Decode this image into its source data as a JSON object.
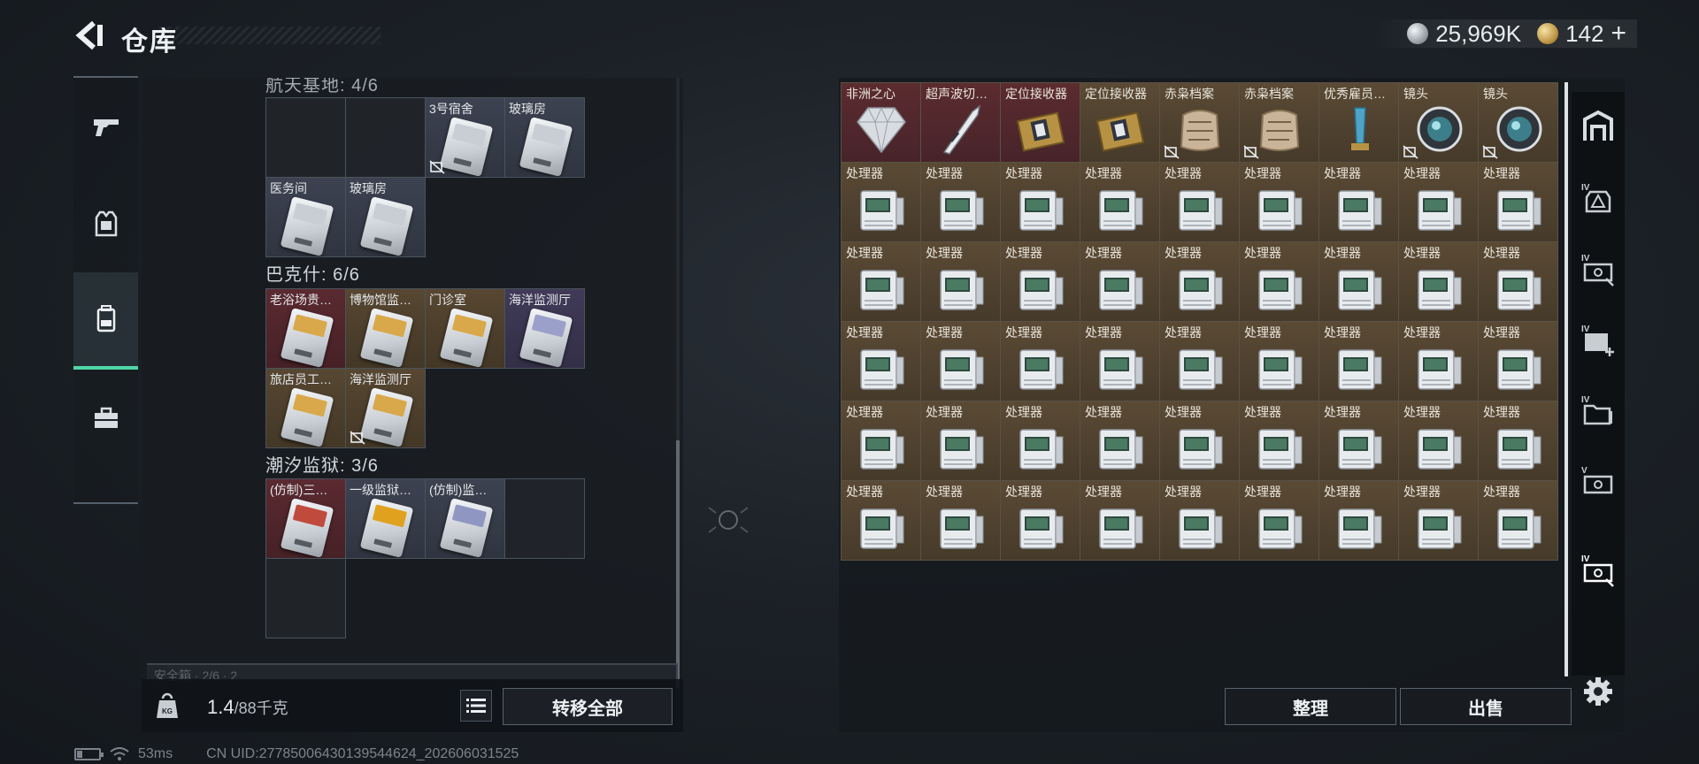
{
  "header": {
    "title": "仓库",
    "silver_amount": "25,969K",
    "gold_amount": "142",
    "plus": "+",
    "tiny_code": "•••• •••"
  },
  "left_nav": {
    "items": [
      "weapons",
      "armor",
      "backpack",
      "toolbox"
    ],
    "active_index": 2
  },
  "left_panel": {
    "cut_group_label": "航天基地: 4/6",
    "groups": [
      {
        "label": "",
        "rows": [
          [
            {
              "label": "",
              "color": "empty"
            },
            {
              "label": "",
              "color": "empty"
            },
            {
              "label": "3号宿舍",
              "color": "gray",
              "lost": true
            },
            {
              "label": "玻璃房",
              "color": "gray",
              "lost": false
            }
          ],
          [
            {
              "label": "医务间",
              "color": "gray",
              "lost": false
            },
            {
              "label": "玻璃房",
              "color": "gray",
              "lost": false
            }
          ]
        ]
      },
      {
        "label": "巴克什: 6/6",
        "rows": [
          [
            {
              "label": "老浴场贵…",
              "color": "red"
            },
            {
              "label": "博物馆监…",
              "color": "gold"
            },
            {
              "label": "门诊室",
              "color": "gold"
            },
            {
              "label": "海洋监测厅",
              "color": "purple"
            }
          ],
          [
            {
              "label": "旅店员工…",
              "color": "gold"
            },
            {
              "label": "海洋监测厅",
              "color": "gold",
              "lost": true
            }
          ]
        ]
      },
      {
        "label": "潮汐监狱: 3/6",
        "rows": [
          [
            {
              "label": "(仿制)三…",
              "color": "red"
            },
            {
              "label": "一级监狱…",
              "color": "gray"
            },
            {
              "label": "(仿制)监…",
              "color": "gray"
            },
            {
              "label": "",
              "color": "empty"
            }
          ],
          [
            {
              "label": "",
              "color": "empty"
            }
          ]
        ]
      }
    ],
    "bottom_cut_label": "安全箱 · 2/6 · 2"
  },
  "weight": {
    "current": "1.4",
    "max": "/88千克",
    "icon_text": "KG"
  },
  "buttons": {
    "transfer_all": "转移全部",
    "sort": "整理",
    "sell": "出售"
  },
  "status": {
    "ping": "53ms",
    "uid": "CN UID:27785006430139544624_202606031525"
  },
  "right_grid": {
    "top_row": [
      {
        "label": "非洲之心",
        "color": "red",
        "icon": "diamond-icon"
      },
      {
        "label": "超声波切…",
        "color": "red",
        "icon": "scalpel-icon"
      },
      {
        "label": "定位接收器",
        "color": "red",
        "icon": "receiver-icon"
      },
      {
        "label": "定位接收器",
        "color": "gold",
        "icon": "receiver-icon"
      },
      {
        "label": "赤枭档案",
        "color": "gold",
        "icon": "archive-icon",
        "lost": true
      },
      {
        "label": "赤枭档案",
        "color": "gold",
        "icon": "archive-icon",
        "lost": true
      },
      {
        "label": "优秀雇员…",
        "color": "gold",
        "icon": "trophy-icon"
      },
      {
        "label": "镜头",
        "color": "gold",
        "icon": "lens-icon",
        "lost": true
      },
      {
        "label": "镜头",
        "color": "gold",
        "icon": "lens-icon",
        "lost": true
      }
    ],
    "processor_label": "处理器",
    "processor_rows": 5,
    "processor_cols": 9
  },
  "colors": {
    "accent": "#4fd6a8",
    "gold_cell": "#5a4a35",
    "red_cell": "#5b2b2f",
    "gray_cell": "#3c4250",
    "purple_cell": "#403a58"
  },
  "right_tabs": [
    "safehouse-icon",
    "tier4-armor-icon",
    "tier4-case-icon",
    "tier4-case-add-icon",
    "tier4-folder-icon",
    "tier5-case-icon",
    "tier4-case-selected-icon"
  ]
}
